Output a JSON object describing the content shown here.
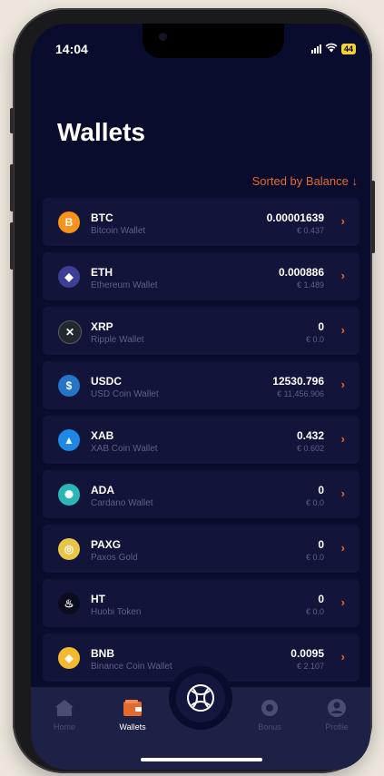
{
  "status_bar": {
    "time": "14:04",
    "battery": "44"
  },
  "header": {
    "title": "Wallets",
    "sort_label": "Sorted by Balance ↓"
  },
  "wallets": [
    {
      "symbol": "BTC",
      "name": "Bitcoin Wallet",
      "balance": "0.00001639",
      "fiat": "€ 0.437",
      "color": "#f7931a",
      "icon": "bitcoin-icon",
      "glyph": "B"
    },
    {
      "symbol": "ETH",
      "name": "Ethereum Wallet",
      "balance": "0.000886",
      "fiat": "€ 1.489",
      "color": "#3c3f95",
      "icon": "ethereum-icon",
      "glyph": "◆"
    },
    {
      "symbol": "XRP",
      "name": "Ripple Wallet",
      "balance": "0",
      "fiat": "€ 0.0",
      "color": "#23272e",
      "icon": "ripple-icon",
      "glyph": "✕"
    },
    {
      "symbol": "USDC",
      "name": "USD Coin Wallet",
      "balance": "12530.796",
      "fiat": "€ 11,456.906",
      "color": "#2775ca",
      "icon": "usd-coin-icon",
      "glyph": "$"
    },
    {
      "symbol": "XAB",
      "name": "XAB Coin Wallet",
      "balance": "0.432",
      "fiat": "€ 0.602",
      "color": "#1e88e5",
      "icon": "xab-icon",
      "glyph": "▲"
    },
    {
      "symbol": "ADA",
      "name": "Cardano Wallet",
      "balance": "0",
      "fiat": "€ 0.0",
      "color": "#2ab6b6",
      "icon": "cardano-icon",
      "glyph": "✺"
    },
    {
      "symbol": "PAXG",
      "name": "Paxos Gold",
      "balance": "0",
      "fiat": "€ 0.0",
      "color": "#e8c547",
      "icon": "paxos-gold-icon",
      "glyph": "◎"
    },
    {
      "symbol": "HT",
      "name": "Huobi Token",
      "balance": "0",
      "fiat": "€ 0.0",
      "color": "#0b0d1e",
      "icon": "huobi-token-icon",
      "glyph": "♨"
    },
    {
      "symbol": "BNB",
      "name": "Binance Coin Wallet",
      "balance": "0.0095",
      "fiat": "€ 2.107",
      "color": "#f3ba2f",
      "icon": "binance-coin-icon",
      "glyph": "◈"
    }
  ],
  "nav": {
    "home": "Home",
    "wallets": "Wallets",
    "bonus": "Bonus",
    "profile": "Profile"
  },
  "accent_color": "#e36a2e"
}
